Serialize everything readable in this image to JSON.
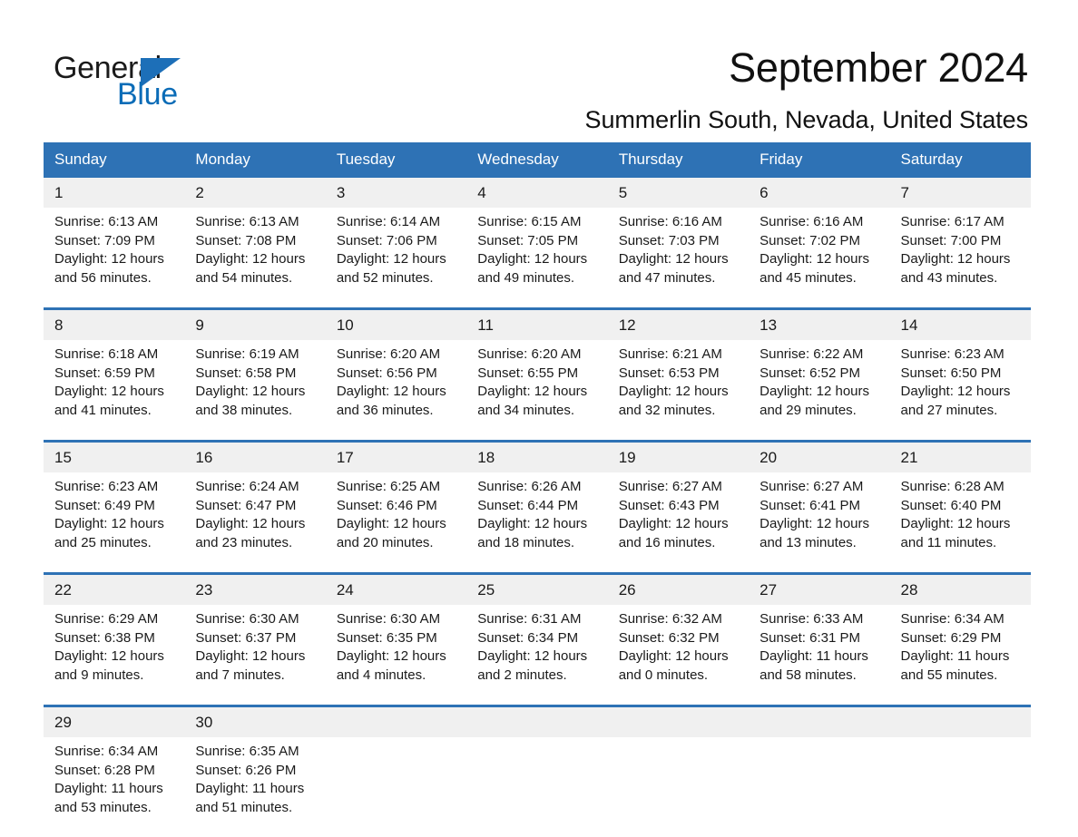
{
  "brand": {
    "name_part1": "General",
    "name_part2": "Blue",
    "triangle_color": "#1d6fb8",
    "blue_text_color": "#0b6cb7"
  },
  "header": {
    "month_title": "September 2024",
    "location": "Summerlin South, Nevada, United States"
  },
  "theme": {
    "header_blue": "#2e72b5",
    "daynum_band": "#f0f0f0",
    "text": "#1a1a1a"
  },
  "calendar": {
    "weekday_headers": [
      "Sunday",
      "Monday",
      "Tuesday",
      "Wednesday",
      "Thursday",
      "Friday",
      "Saturday"
    ],
    "weeks": [
      [
        {
          "day": "1",
          "sunrise": "Sunrise: 6:13 AM",
          "sunset": "Sunset: 7:09 PM",
          "daylight_line1": "Daylight: 12 hours",
          "daylight_line2": "and 56 minutes."
        },
        {
          "day": "2",
          "sunrise": "Sunrise: 6:13 AM",
          "sunset": "Sunset: 7:08 PM",
          "daylight_line1": "Daylight: 12 hours",
          "daylight_line2": "and 54 minutes."
        },
        {
          "day": "3",
          "sunrise": "Sunrise: 6:14 AM",
          "sunset": "Sunset: 7:06 PM",
          "daylight_line1": "Daylight: 12 hours",
          "daylight_line2": "and 52 minutes."
        },
        {
          "day": "4",
          "sunrise": "Sunrise: 6:15 AM",
          "sunset": "Sunset: 7:05 PM",
          "daylight_line1": "Daylight: 12 hours",
          "daylight_line2": "and 49 minutes."
        },
        {
          "day": "5",
          "sunrise": "Sunrise: 6:16 AM",
          "sunset": "Sunset: 7:03 PM",
          "daylight_line1": "Daylight: 12 hours",
          "daylight_line2": "and 47 minutes."
        },
        {
          "day": "6",
          "sunrise": "Sunrise: 6:16 AM",
          "sunset": "Sunset: 7:02 PM",
          "daylight_line1": "Daylight: 12 hours",
          "daylight_line2": "and 45 minutes."
        },
        {
          "day": "7",
          "sunrise": "Sunrise: 6:17 AM",
          "sunset": "Sunset: 7:00 PM",
          "daylight_line1": "Daylight: 12 hours",
          "daylight_line2": "and 43 minutes."
        }
      ],
      [
        {
          "day": "8",
          "sunrise": "Sunrise: 6:18 AM",
          "sunset": "Sunset: 6:59 PM",
          "daylight_line1": "Daylight: 12 hours",
          "daylight_line2": "and 41 minutes."
        },
        {
          "day": "9",
          "sunrise": "Sunrise: 6:19 AM",
          "sunset": "Sunset: 6:58 PM",
          "daylight_line1": "Daylight: 12 hours",
          "daylight_line2": "and 38 minutes."
        },
        {
          "day": "10",
          "sunrise": "Sunrise: 6:20 AM",
          "sunset": "Sunset: 6:56 PM",
          "daylight_line1": "Daylight: 12 hours",
          "daylight_line2": "and 36 minutes."
        },
        {
          "day": "11",
          "sunrise": "Sunrise: 6:20 AM",
          "sunset": "Sunset: 6:55 PM",
          "daylight_line1": "Daylight: 12 hours",
          "daylight_line2": "and 34 minutes."
        },
        {
          "day": "12",
          "sunrise": "Sunrise: 6:21 AM",
          "sunset": "Sunset: 6:53 PM",
          "daylight_line1": "Daylight: 12 hours",
          "daylight_line2": "and 32 minutes."
        },
        {
          "day": "13",
          "sunrise": "Sunrise: 6:22 AM",
          "sunset": "Sunset: 6:52 PM",
          "daylight_line1": "Daylight: 12 hours",
          "daylight_line2": "and 29 minutes."
        },
        {
          "day": "14",
          "sunrise": "Sunrise: 6:23 AM",
          "sunset": "Sunset: 6:50 PM",
          "daylight_line1": "Daylight: 12 hours",
          "daylight_line2": "and 27 minutes."
        }
      ],
      [
        {
          "day": "15",
          "sunrise": "Sunrise: 6:23 AM",
          "sunset": "Sunset: 6:49 PM",
          "daylight_line1": "Daylight: 12 hours",
          "daylight_line2": "and 25 minutes."
        },
        {
          "day": "16",
          "sunrise": "Sunrise: 6:24 AM",
          "sunset": "Sunset: 6:47 PM",
          "daylight_line1": "Daylight: 12 hours",
          "daylight_line2": "and 23 minutes."
        },
        {
          "day": "17",
          "sunrise": "Sunrise: 6:25 AM",
          "sunset": "Sunset: 6:46 PM",
          "daylight_line1": "Daylight: 12 hours",
          "daylight_line2": "and 20 minutes."
        },
        {
          "day": "18",
          "sunrise": "Sunrise: 6:26 AM",
          "sunset": "Sunset: 6:44 PM",
          "daylight_line1": "Daylight: 12 hours",
          "daylight_line2": "and 18 minutes."
        },
        {
          "day": "19",
          "sunrise": "Sunrise: 6:27 AM",
          "sunset": "Sunset: 6:43 PM",
          "daylight_line1": "Daylight: 12 hours",
          "daylight_line2": "and 16 minutes."
        },
        {
          "day": "20",
          "sunrise": "Sunrise: 6:27 AM",
          "sunset": "Sunset: 6:41 PM",
          "daylight_line1": "Daylight: 12 hours",
          "daylight_line2": "and 13 minutes."
        },
        {
          "day": "21",
          "sunrise": "Sunrise: 6:28 AM",
          "sunset": "Sunset: 6:40 PM",
          "daylight_line1": "Daylight: 12 hours",
          "daylight_line2": "and 11 minutes."
        }
      ],
      [
        {
          "day": "22",
          "sunrise": "Sunrise: 6:29 AM",
          "sunset": "Sunset: 6:38 PM",
          "daylight_line1": "Daylight: 12 hours",
          "daylight_line2": "and 9 minutes."
        },
        {
          "day": "23",
          "sunrise": "Sunrise: 6:30 AM",
          "sunset": "Sunset: 6:37 PM",
          "daylight_line1": "Daylight: 12 hours",
          "daylight_line2": "and 7 minutes."
        },
        {
          "day": "24",
          "sunrise": "Sunrise: 6:30 AM",
          "sunset": "Sunset: 6:35 PM",
          "daylight_line1": "Daylight: 12 hours",
          "daylight_line2": "and 4 minutes."
        },
        {
          "day": "25",
          "sunrise": "Sunrise: 6:31 AM",
          "sunset": "Sunset: 6:34 PM",
          "daylight_line1": "Daylight: 12 hours",
          "daylight_line2": "and 2 minutes."
        },
        {
          "day": "26",
          "sunrise": "Sunrise: 6:32 AM",
          "sunset": "Sunset: 6:32 PM",
          "daylight_line1": "Daylight: 12 hours",
          "daylight_line2": "and 0 minutes."
        },
        {
          "day": "27",
          "sunrise": "Sunrise: 6:33 AM",
          "sunset": "Sunset: 6:31 PM",
          "daylight_line1": "Daylight: 11 hours",
          "daylight_line2": "and 58 minutes."
        },
        {
          "day": "28",
          "sunrise": "Sunrise: 6:34 AM",
          "sunset": "Sunset: 6:29 PM",
          "daylight_line1": "Daylight: 11 hours",
          "daylight_line2": "and 55 minutes."
        }
      ],
      [
        {
          "day": "29",
          "sunrise": "Sunrise: 6:34 AM",
          "sunset": "Sunset: 6:28 PM",
          "daylight_line1": "Daylight: 11 hours",
          "daylight_line2": "and 53 minutes."
        },
        {
          "day": "30",
          "sunrise": "Sunrise: 6:35 AM",
          "sunset": "Sunset: 6:26 PM",
          "daylight_line1": "Daylight: 11 hours",
          "daylight_line2": "and 51 minutes."
        },
        {
          "day": "",
          "sunrise": "",
          "sunset": "",
          "daylight_line1": "",
          "daylight_line2": ""
        },
        {
          "day": "",
          "sunrise": "",
          "sunset": "",
          "daylight_line1": "",
          "daylight_line2": ""
        },
        {
          "day": "",
          "sunrise": "",
          "sunset": "",
          "daylight_line1": "",
          "daylight_line2": ""
        },
        {
          "day": "",
          "sunrise": "",
          "sunset": "",
          "daylight_line1": "",
          "daylight_line2": ""
        },
        {
          "day": "",
          "sunrise": "",
          "sunset": "",
          "daylight_line1": "",
          "daylight_line2": ""
        }
      ]
    ]
  }
}
